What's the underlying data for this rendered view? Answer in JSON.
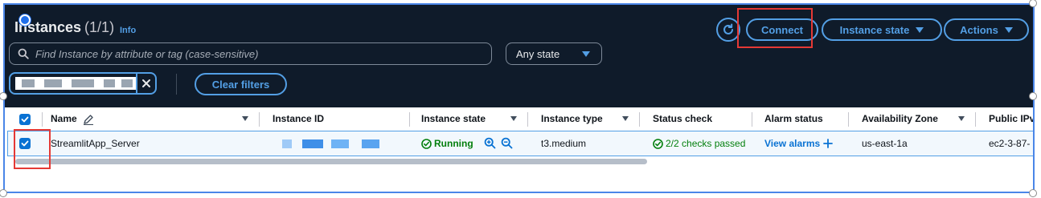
{
  "header": {
    "title": "Instances",
    "count": "(1/1)",
    "info_label": "Info",
    "connect_label": "Connect",
    "instance_state_label": "Instance state",
    "actions_label": "Actions"
  },
  "filters": {
    "search_placeholder": "Find Instance by attribute or tag (case-sensitive)",
    "state_select_value": "Any state",
    "clear_filters_label": "Clear filters"
  },
  "table": {
    "columns": {
      "name": "Name",
      "instance_id": "Instance ID",
      "instance_state": "Instance state",
      "instance_type": "Instance type",
      "status_check": "Status check",
      "alarm_status": "Alarm status",
      "availability_zone": "Availability Zone",
      "public_ip": "Public IPv"
    },
    "row": {
      "name": "StreamlitApp_Server",
      "instance_state": "Running",
      "instance_type": "t3.medium",
      "status_check": "2/2 checks passed",
      "alarm_status": "View alarms",
      "availability_zone": "us-east-1a",
      "public_ip": "ec2-3-87-"
    }
  },
  "colors": {
    "header_bg": "#0f1b2a",
    "accent_link": "#539fe5",
    "primary_blue": "#0972d3",
    "success_green": "#037f0c",
    "annotation_red": "#e53935"
  }
}
